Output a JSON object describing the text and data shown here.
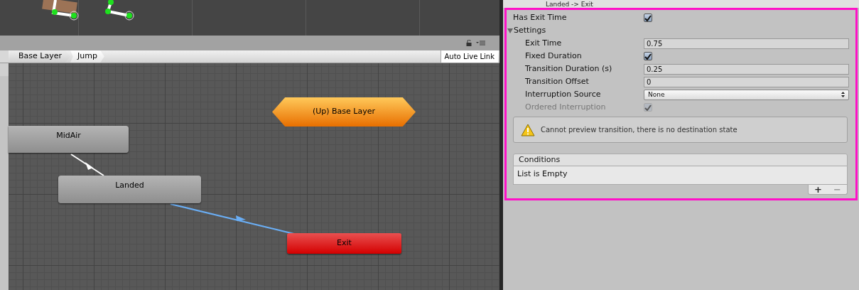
{
  "breadcrumbs": [
    {
      "label": "Base Layer",
      "selected": false
    },
    {
      "label": "Jump",
      "selected": true
    }
  ],
  "auto_live_link": "Auto Live Link",
  "nodes": [
    {
      "kind": "state",
      "label": "MidAir"
    },
    {
      "kind": "state",
      "label": "Landed"
    },
    {
      "kind": "exit",
      "label": "Exit"
    },
    {
      "kind": "up",
      "label": "(Up) Base Layer"
    }
  ],
  "inspector": {
    "header": "Landed  -> Exit",
    "rows": [
      {
        "kind": "checkbox",
        "label": "Has Exit Time",
        "checked": true,
        "disabled": false
      },
      {
        "kind": "section",
        "label": "Settings",
        "expanded": true
      },
      {
        "kind": "text",
        "label": "Exit Time",
        "value": "0.75"
      },
      {
        "kind": "checkbox",
        "label": "Fixed Duration",
        "checked": true,
        "disabled": false
      },
      {
        "kind": "text",
        "label": "Transition Duration (s)",
        "value": "0.25"
      },
      {
        "kind": "text",
        "label": "Transition Offset",
        "value": "0"
      },
      {
        "kind": "dropdown",
        "label": "Interruption Source",
        "value": "None"
      },
      {
        "kind": "checkbox",
        "label": "Ordered Interruption",
        "checked": true,
        "disabled": true
      }
    ],
    "warning": "Cannot preview transition, there is no destination state",
    "conditions": {
      "title": "Conditions",
      "empty_text": "List is Empty",
      "buttons": [
        "+",
        "−"
      ]
    }
  }
}
